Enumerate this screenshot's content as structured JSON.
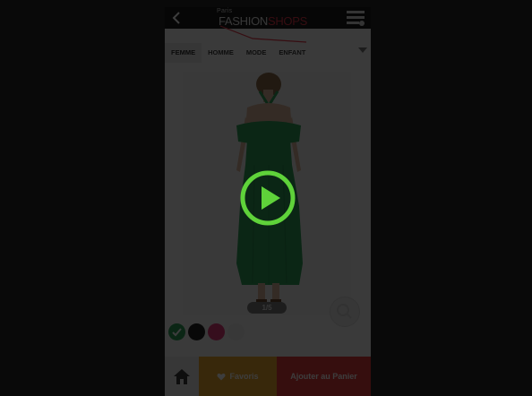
{
  "app": {
    "logo_small": "Paris",
    "logo_part1": "FASHION",
    "logo_part2": "SHOPS"
  },
  "tabs": [
    {
      "label": "FEMME",
      "active": true
    },
    {
      "label": "HOMME",
      "active": false
    },
    {
      "label": "MODE",
      "active": false
    },
    {
      "label": "ENFANT",
      "active": false
    }
  ],
  "product": {
    "image_counter": "1/5",
    "dress_color": "#2f9e5a"
  },
  "swatches": [
    {
      "color": "#2f9e5a",
      "selected": true
    },
    {
      "color": "#222222",
      "selected": false
    },
    {
      "color": "#e23a7a",
      "selected": false
    },
    {
      "color": "#e8e8e8",
      "selected": false
    }
  ],
  "bottom_bar": {
    "favoris_label": "Favoris",
    "cart_label": "Ajouter au Panier"
  },
  "colors": {
    "accent_play": "#5fd23a",
    "favoris_bg": "#e9a731",
    "cart_bg": "#e23a3a",
    "topbar_bg": "#1b1b1b"
  },
  "icons": {
    "back": "chevron-left-icon",
    "menu": "list-menu-icon",
    "home": "home-icon",
    "favorite": "heart-icon",
    "play": "play-icon"
  }
}
